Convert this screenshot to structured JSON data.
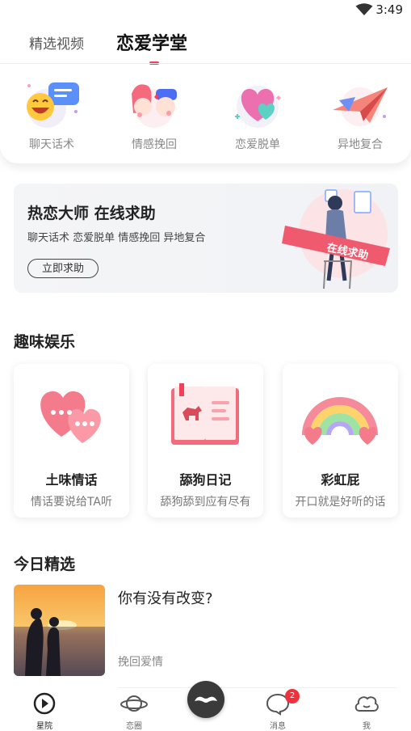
{
  "status_bar": {
    "time": "3:49",
    "wifi_icon": "wifi-icon"
  },
  "top_tabs": {
    "videos": "精选视频",
    "school": "恋爱学堂",
    "active": "school"
  },
  "categories": [
    {
      "label": "聊天话术",
      "icon": "chat-emoji-icon"
    },
    {
      "label": "情感挽回",
      "icon": "couple-icon"
    },
    {
      "label": "恋爱脱单",
      "icon": "hearts-icon"
    },
    {
      "label": "异地复合",
      "icon": "paper-plane-icon"
    }
  ],
  "banner": {
    "title": "热恋大师 在线求助",
    "subtitle": "聊天话术 恋爱脱单 情感挽回 异地复合",
    "cta": "立即求助",
    "ribbon": "在线求助"
  },
  "fun_section": {
    "title": "趣味娱乐",
    "cards": [
      {
        "name": "土味情话",
        "desc": "情话要说给TA听",
        "icon": "chat-hearts-icon"
      },
      {
        "name": "舔狗日记",
        "desc": "舔狗舔到应有尽有",
        "icon": "dog-diary-book-icon"
      },
      {
        "name": "彩虹屁",
        "desc": "开口就是好听的话",
        "icon": "rainbow-icon"
      }
    ]
  },
  "today_section": {
    "title": "今日精选",
    "item": {
      "title": "你有没有改变?",
      "tag": "挽回爱情"
    }
  },
  "bottom_nav": {
    "items": [
      {
        "label": "星院",
        "icon": "play-circle-icon",
        "active": true
      },
      {
        "label": "恋圈",
        "icon": "planet-icon",
        "active": false
      },
      {
        "label": "",
        "icon": "mustache-icon",
        "active": false
      },
      {
        "label": "消息",
        "icon": "message-bubble-icon",
        "active": false,
        "badge": "2"
      },
      {
        "label": "我",
        "icon": "cloud-face-icon",
        "active": false
      }
    ]
  },
  "colors": {
    "accent": "#f0405a",
    "badge": "#f0303a",
    "center_button": "#3a3a3a"
  }
}
